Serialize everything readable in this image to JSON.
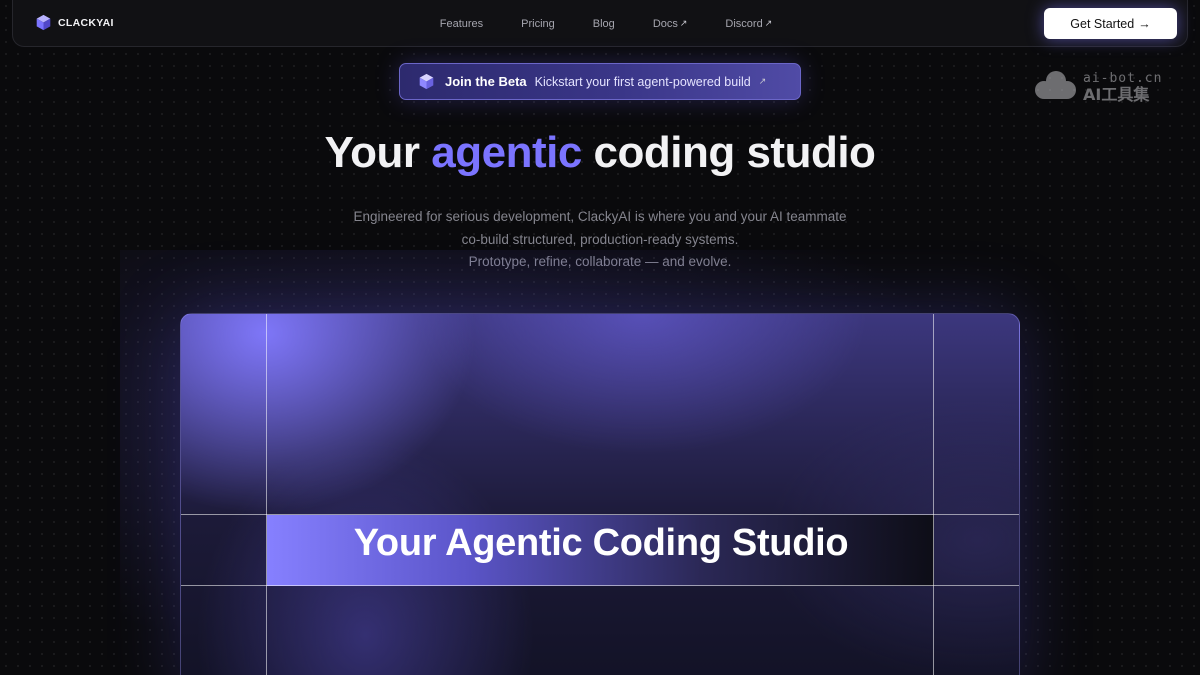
{
  "brand": {
    "name": "CLACKYAI"
  },
  "nav": {
    "items": [
      {
        "label": "Features",
        "external": false
      },
      {
        "label": "Pricing",
        "external": false
      },
      {
        "label": "Blog",
        "external": false
      },
      {
        "label": "Docs",
        "external": true
      },
      {
        "label": "Discord",
        "external": true
      }
    ],
    "external_glyph": "↗"
  },
  "cta": {
    "label": "Get Started",
    "arrow": "→"
  },
  "beta": {
    "title": "Join the Beta",
    "subtitle": "Kickstart your first agent-powered build",
    "arrow": "↗"
  },
  "hero": {
    "title_prefix": "Your",
    "title_accent": "agentic",
    "title_suffix": "coding studio",
    "description": [
      "Engineered for serious development, ClackyAI is where you and your AI teammate",
      "co-build structured, production-ready systems.",
      "Prototype, refine, collaborate — and evolve."
    ]
  },
  "panel": {
    "title": "Your Agentic Coding Studio"
  },
  "watermark": {
    "top": "ai-bot.cn",
    "bottom": "AI工具集"
  },
  "colors": {
    "accent": "#7b74ff",
    "background": "#0a0a0c",
    "cta_bg": "#ffffff"
  }
}
